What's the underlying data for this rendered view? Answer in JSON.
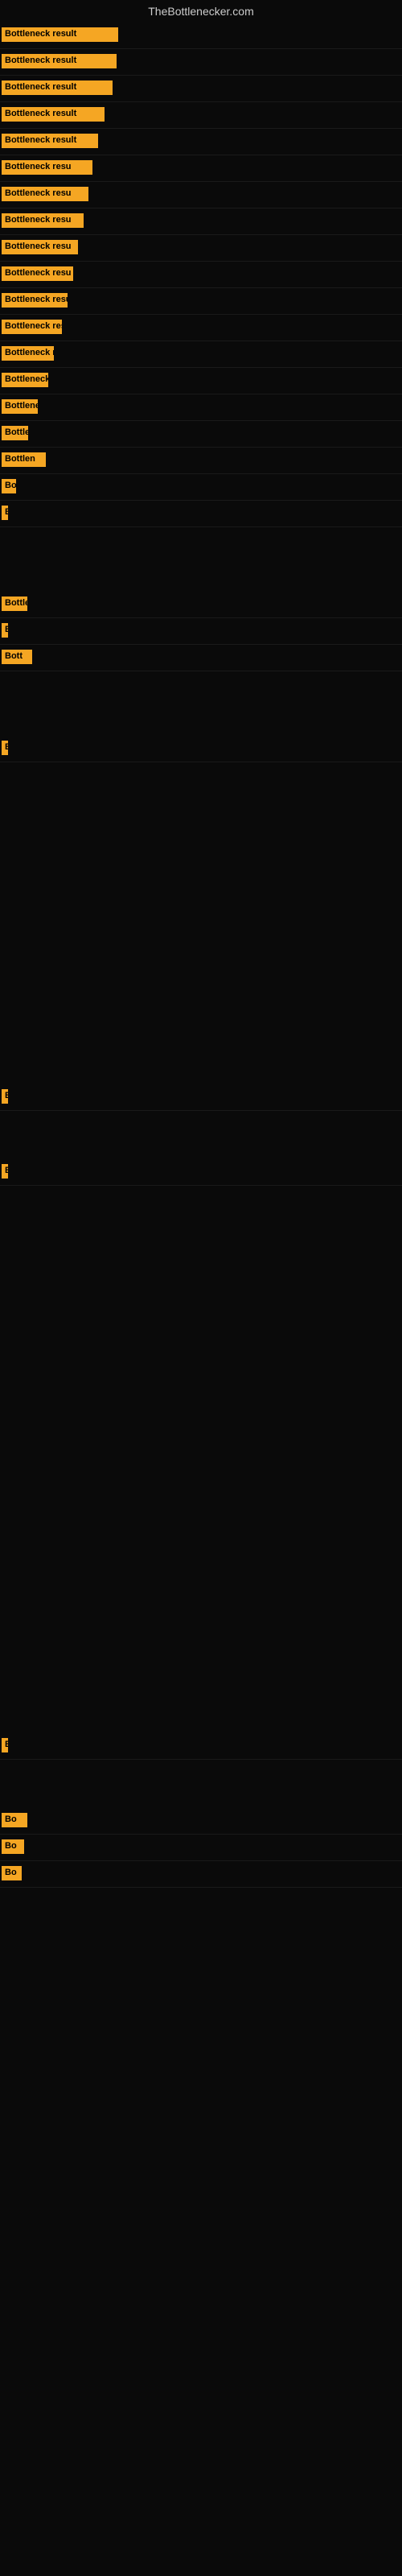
{
  "site": {
    "title": "TheBottlenecker.com"
  },
  "rows": [
    {
      "id": 1,
      "label": "Bottleneck result",
      "class": "row-1"
    },
    {
      "id": 2,
      "label": "Bottleneck result",
      "class": "row-2"
    },
    {
      "id": 3,
      "label": "Bottleneck result",
      "class": "row-3"
    },
    {
      "id": 4,
      "label": "Bottleneck result",
      "class": "row-4"
    },
    {
      "id": 5,
      "label": "Bottleneck result",
      "class": "row-5"
    },
    {
      "id": 6,
      "label": "Bottleneck resu",
      "class": "row-6"
    },
    {
      "id": 7,
      "label": "Bottleneck resu",
      "class": "row-7"
    },
    {
      "id": 8,
      "label": "Bottleneck resu",
      "class": "row-8"
    },
    {
      "id": 9,
      "label": "Bottleneck resu",
      "class": "row-9"
    },
    {
      "id": 10,
      "label": "Bottleneck resu",
      "class": "row-10"
    },
    {
      "id": 11,
      "label": "Bottleneck resu",
      "class": "row-11"
    },
    {
      "id": 12,
      "label": "Bottleneck res",
      "class": "row-12"
    },
    {
      "id": 13,
      "label": "Bottleneck re",
      "class": "row-13"
    },
    {
      "id": 14,
      "label": "Bottleneck re",
      "class": "row-14"
    },
    {
      "id": 15,
      "label": "Bottleneck r",
      "class": "row-15"
    },
    {
      "id": 16,
      "label": "Bottleneck",
      "class": "row-16"
    },
    {
      "id": 17,
      "label": "Bottlen",
      "class": "row-17"
    },
    {
      "id": 18,
      "label": "Bo",
      "class": "row-18"
    },
    {
      "id": 19,
      "label": "B",
      "class": "row-19"
    },
    {
      "id": 20,
      "label": "Bottle",
      "class": "row-20"
    },
    {
      "id": 21,
      "label": "B",
      "class": "row-21"
    },
    {
      "id": 22,
      "label": "Bott",
      "class": "row-22"
    },
    {
      "id": 23,
      "label": "B",
      "class": "row-23"
    }
  ],
  "late_rows": [
    {
      "id": 24,
      "label": "B",
      "class": "row-24"
    },
    {
      "id": 25,
      "label": "B",
      "class": "row-25"
    },
    {
      "id": 26,
      "label": "B",
      "class": "row-26"
    },
    {
      "id": 27,
      "label": "Bo",
      "class": "row-27"
    },
    {
      "id": 28,
      "label": "Bo",
      "class": "row-28"
    },
    {
      "id": 29,
      "label": "Bo",
      "class": "row-29"
    }
  ]
}
